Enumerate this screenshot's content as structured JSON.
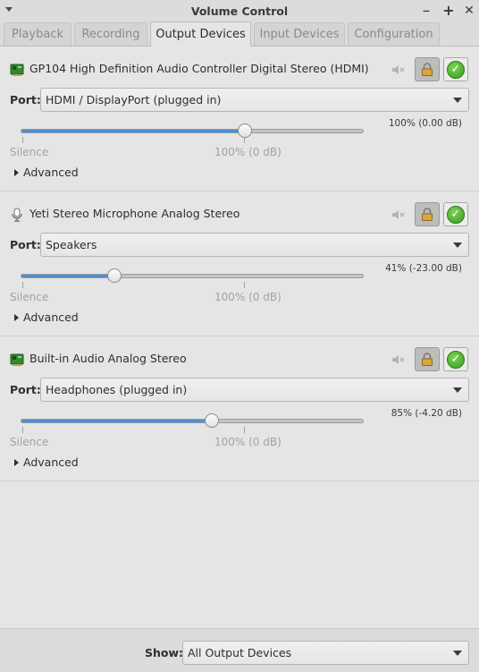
{
  "window": {
    "title": "Volume Control",
    "controls": {
      "minimize": "–",
      "maximize": "+",
      "close": "✕"
    }
  },
  "tabs": [
    {
      "label": "Playback",
      "active": false
    },
    {
      "label": "Recording",
      "active": false
    },
    {
      "label": "Output Devices",
      "active": true
    },
    {
      "label": "Input Devices",
      "active": false
    },
    {
      "label": "Configuration",
      "active": false
    }
  ],
  "common": {
    "port_label": "Port:",
    "silence_label": "Silence",
    "zero_db_label": "100% (0 dB)",
    "advanced_label": "Advanced"
  },
  "devices": [
    {
      "name": "GP104 High Definition Audio Controller Digital Stereo (HDMI)",
      "icon": "audio-card-icon",
      "port": "HDMI / DisplayPort (plugged in)",
      "volume_percent": 100,
      "volume_text": "100% (0.00 dB)",
      "locked": true,
      "is_default": true
    },
    {
      "name": "Yeti Stereo Microphone Analog Stereo",
      "icon": "microphone-icon",
      "port": "Speakers",
      "volume_percent": 41,
      "volume_text": "41% (-23.00 dB)",
      "locked": true,
      "is_default": true
    },
    {
      "name": "Built-in Audio Analog Stereo",
      "icon": "audio-card-icon",
      "port": "Headphones (plugged in)",
      "volume_percent": 85,
      "volume_text": "85% (-4.20 dB)",
      "locked": true,
      "is_default": true
    }
  ],
  "footer": {
    "show_label": "Show:",
    "show_value": "All Output Devices"
  },
  "colors": {
    "accent": "#4a90d9",
    "check_green": "#3a9a1f",
    "card_icon_green": "#2f8a2f"
  }
}
